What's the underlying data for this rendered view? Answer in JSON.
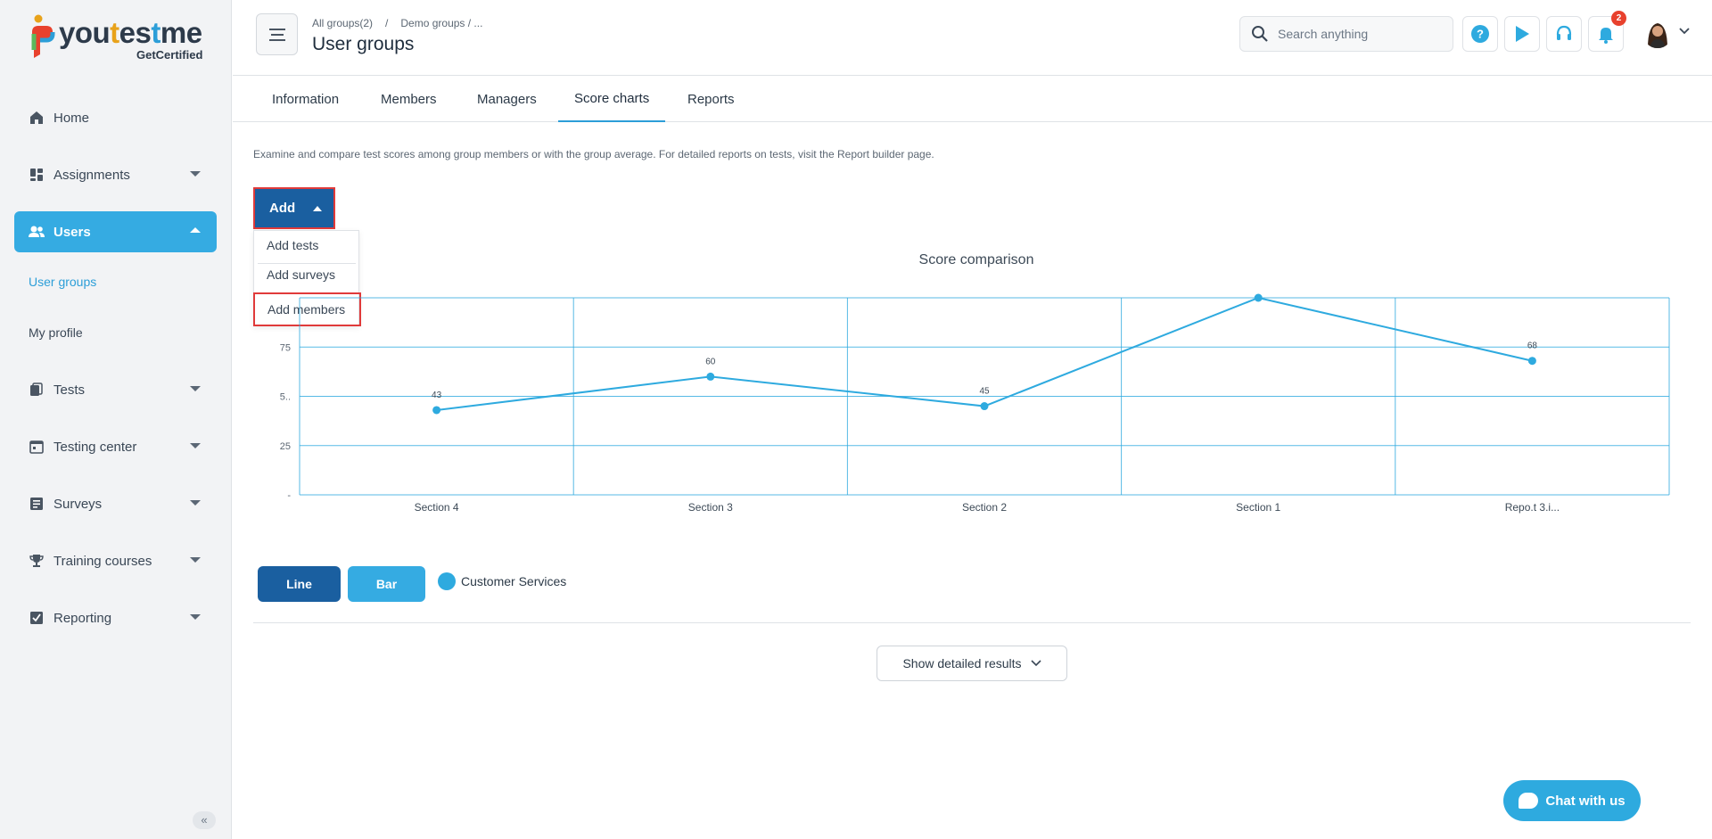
{
  "brand": {
    "name_prefix": "you",
    "name_t1": "t",
    "name_mid": "es",
    "name_t2": "t",
    "name_suffix": "me",
    "tagline": "GetCertified"
  },
  "sidebar": {
    "items": [
      {
        "label": "Home",
        "icon": "home-icon"
      },
      {
        "label": "Assignments",
        "icon": "assignments-icon"
      },
      {
        "label": "Users",
        "icon": "users-icon",
        "active": true
      },
      {
        "label": "Tests",
        "icon": "tests-icon"
      },
      {
        "label": "Testing center",
        "icon": "testing-center-icon"
      },
      {
        "label": "Surveys",
        "icon": "surveys-icon"
      },
      {
        "label": "Training courses",
        "icon": "trophy-icon"
      },
      {
        "label": "Reporting",
        "icon": "reporting-icon"
      }
    ],
    "sub_items": [
      {
        "label": "User groups",
        "active": true
      },
      {
        "label": "My profile"
      }
    ],
    "collapse_label": "«"
  },
  "header": {
    "breadcrumb": [
      "All groups(2)",
      "/",
      "Demo groups / ..."
    ],
    "title": "User groups",
    "search_placeholder": "Search anything",
    "notification_count": "2"
  },
  "tabs": [
    "Information",
    "Members",
    "Managers",
    "Score charts",
    "Reports"
  ],
  "active_tab": "Score charts",
  "description": "Examine and compare test scores among group members or with the group average. For detailed reports on tests, visit the Report builder page.",
  "add_button": {
    "label": "Add"
  },
  "add_menu": [
    "Add tests",
    "Add surveys",
    "Add members"
  ],
  "chart_toggle": {
    "line_label": "Line",
    "bar_label": "Bar"
  },
  "show_detail_label": "Show detailed results",
  "chat_label": "Chat with us",
  "colors": {
    "accent": "#35abe2",
    "primary": "#1a5fa0",
    "highlight": "#e03a3a",
    "series": "#2eaadf"
  },
  "chart_data": {
    "type": "line",
    "title": "Score comparison",
    "categories": [
      "Section 4",
      "Section 3",
      "Section 2",
      "Section 1",
      "Repo.t 3.i..."
    ],
    "series": [
      {
        "name": "Customer Services",
        "values": [
          43,
          60,
          45,
          100,
          68
        ]
      }
    ],
    "data_labels": [
      "43",
      "60",
      "45",
      "",
      "68"
    ],
    "y_ticks": [
      "-",
      "25",
      "5..",
      "75"
    ],
    "ylim": [
      0,
      100
    ],
    "grid": true
  }
}
